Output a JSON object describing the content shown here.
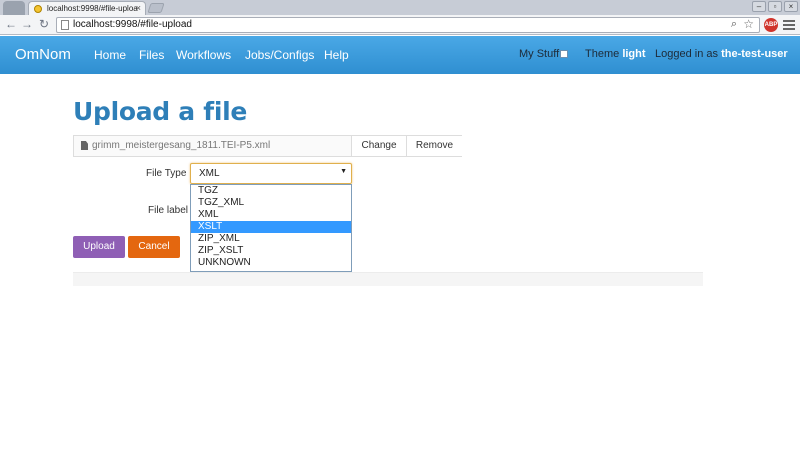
{
  "browser": {
    "tab_title": "localhost:9998/#file-uploa",
    "tab_close": "×",
    "url": "localhost:9998/#file-upload",
    "ext_badge": "ABP",
    "window_buttons": [
      "–",
      "▫",
      "×"
    ]
  },
  "navbar": {
    "brand": "OmNom",
    "links": [
      "Home",
      "Files",
      "Workflows",
      "Jobs/Configs",
      "Help"
    ],
    "my_stuff": "My Stuff",
    "theme_label": "Theme",
    "theme_value": "light",
    "logged_in_label": "Logged in as",
    "user": "the-test-user"
  },
  "page": {
    "title": "Upload a file",
    "file_name": "grimm_meistergesang_1811.TEI-P5.xml",
    "change_label": "Change",
    "remove_label": "Remove",
    "file_type_label": "File Type",
    "file_label_label": "File label",
    "selected_type": "XML",
    "type_options": [
      "TGZ",
      "TGZ_XML",
      "XML",
      "XSLT",
      "ZIP_XML",
      "ZIP_XSLT",
      "UNKNOWN"
    ],
    "highlighted_option": "XSLT",
    "upload_label": "Upload",
    "cancel_label": "Cancel"
  },
  "colors": {
    "navbar": "#3497d8",
    "title": "#2e7fb8",
    "upload_button": "#8f5fb5",
    "cancel_button": "#e4670f",
    "highlight": "#3399ff"
  }
}
